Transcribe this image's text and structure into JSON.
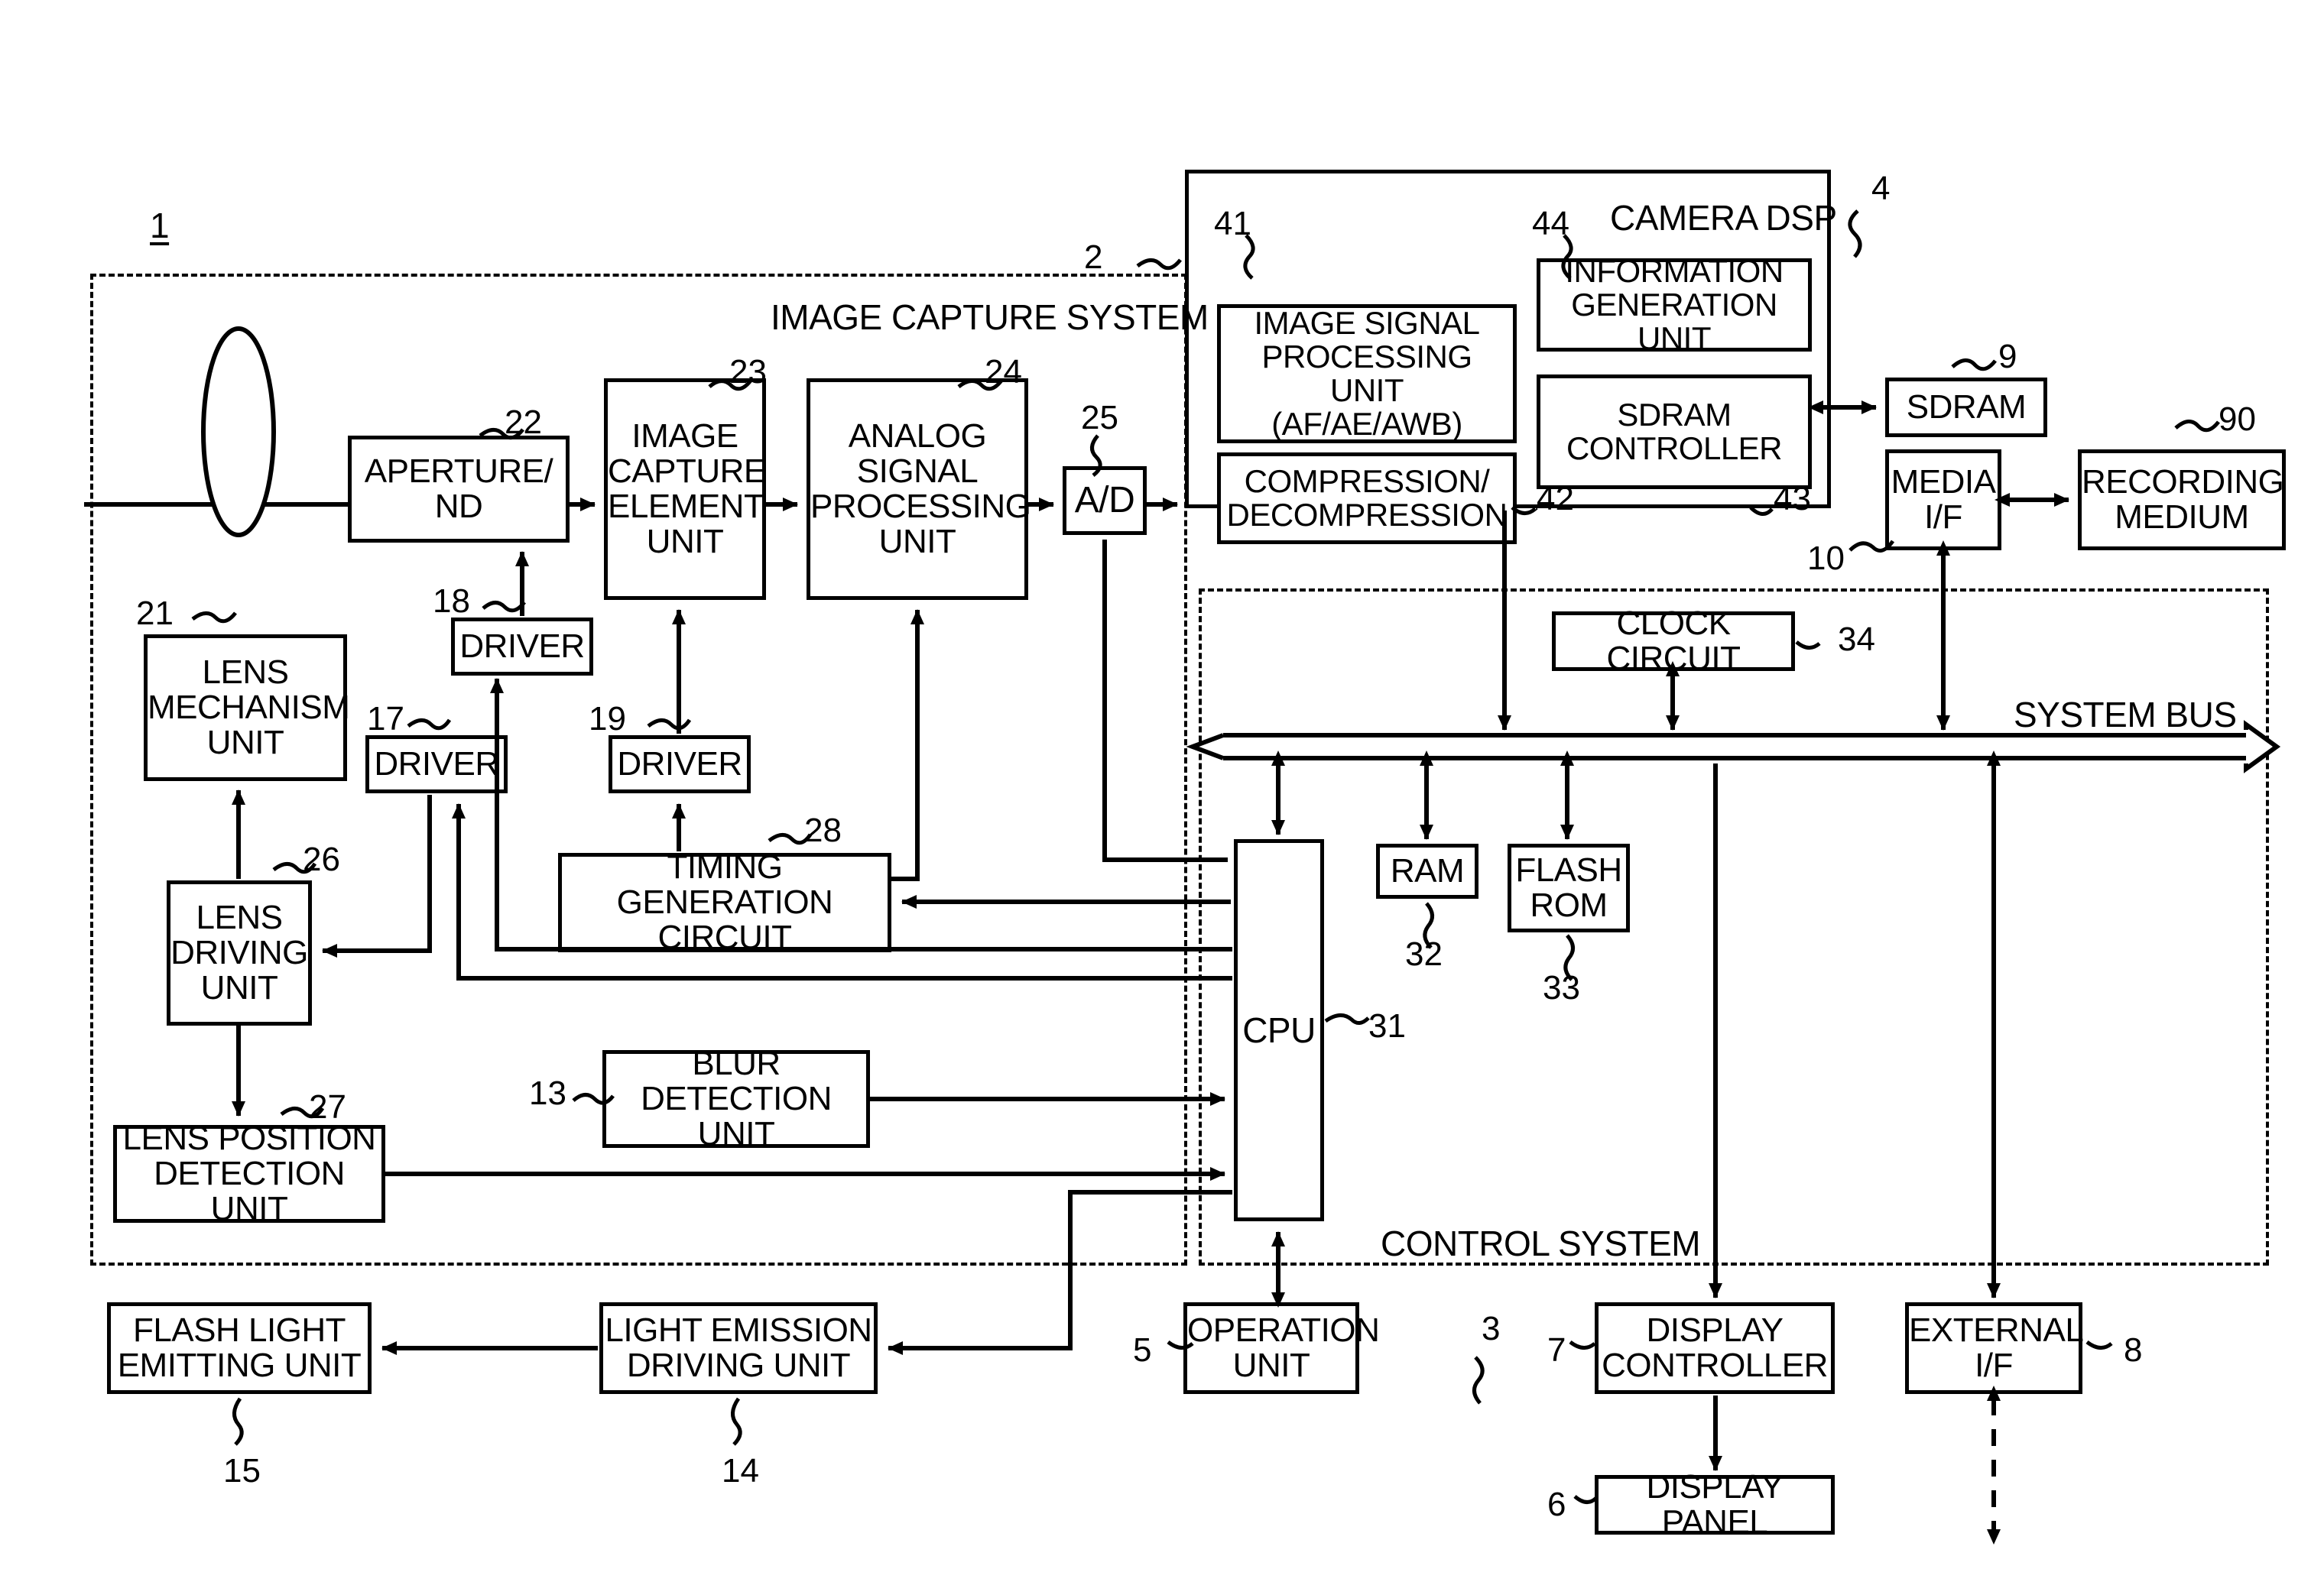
{
  "figure": {
    "device_label": "1",
    "regions": [
      {
        "id": "image-capture-system",
        "label": "IMAGE CAPTURE SYSTEM",
        "ref": "2"
      },
      {
        "id": "control-system",
        "label": "CONTROL SYSTEM",
        "ref": "3"
      },
      {
        "id": "camera-dsp",
        "label": "CAMERA DSP",
        "ref": "4"
      }
    ],
    "bus": {
      "label": "SYSTEM BUS"
    }
  },
  "blocks": {
    "aperture_nd": {
      "label": "APERTURE/\nND",
      "ref": "22"
    },
    "image_capture_element": {
      "label": "IMAGE\nCAPTURE\nELEMENT\nUNIT",
      "ref": "23"
    },
    "analog_signal_processing": {
      "label": "ANALOG\nSIGNAL\nPROCESSING\nUNIT",
      "ref": "24"
    },
    "ad_converter": {
      "label": "A/D",
      "ref": "25"
    },
    "lens_mechanism": {
      "label": "LENS\nMECHANISM\nUNIT",
      "ref": "21"
    },
    "driver_17": {
      "label": "DRIVER",
      "ref": "17"
    },
    "driver_18": {
      "label": "DRIVER",
      "ref": "18"
    },
    "driver_19": {
      "label": "DRIVER",
      "ref": "19"
    },
    "lens_driving": {
      "label": "LENS\nDRIVING\nUNIT",
      "ref": "26"
    },
    "lens_position_detection": {
      "label": "LENS POSITION\nDETECTION UNIT",
      "ref": "27"
    },
    "timing_generation": {
      "label": "TIMING GENERATION\nCIRCUIT",
      "ref": "28"
    },
    "blur_detection": {
      "label": "BLUR\nDETECTION UNIT",
      "ref": "13"
    },
    "image_signal_processing": {
      "label": "IMAGE SIGNAL\nPROCESSING UNIT\n(AF/AE/AWB)",
      "ref": "41"
    },
    "compression_decompression": {
      "label": "COMPRESSION/\nDECOMPRESSION",
      "ref": "42"
    },
    "information_generation": {
      "label": "INFORMATION\nGENERATION UNIT",
      "ref": "44"
    },
    "sdram_controller": {
      "label": "SDRAM\nCONTROLLER",
      "ref": "43"
    },
    "sdram": {
      "label": "SDRAM",
      "ref": "9"
    },
    "media_if": {
      "label": "MEDIA\nI/F",
      "ref": "10"
    },
    "recording_medium": {
      "label": "RECORDING\nMEDIUM",
      "ref": "90"
    },
    "clock_circuit": {
      "label": "CLOCK CIRCUIT",
      "ref": "34"
    },
    "cpu": {
      "label": "CPU",
      "ref": "31"
    },
    "ram": {
      "label": "RAM",
      "ref": "32"
    },
    "flash_rom": {
      "label": "FLASH\nROM",
      "ref": "33"
    },
    "operation_unit": {
      "label": "OPERATION\nUNIT",
      "ref": "5"
    },
    "display_controller": {
      "label": "DISPLAY\nCONTROLLER",
      "ref": "7"
    },
    "display_panel": {
      "label": "DISPLAY PANEL",
      "ref": "6"
    },
    "external_if": {
      "label": "EXTERNAL\nI/F",
      "ref": "8"
    },
    "light_emission_driving": {
      "label": "LIGHT EMISSION\nDRIVING UNIT",
      "ref": "14"
    },
    "flash_light_emitting": {
      "label": "FLASH LIGHT\nEMITTING UNIT",
      "ref": "15"
    }
  },
  "colors": {
    "ink": "#000000",
    "paper": "#ffffff"
  }
}
